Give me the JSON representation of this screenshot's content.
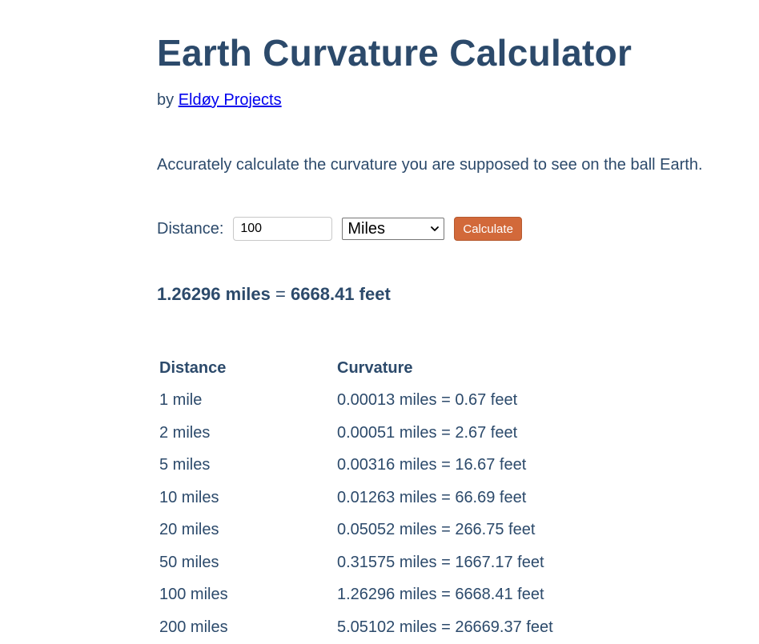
{
  "header": {
    "title": "Earth Curvature Calculator",
    "byline_prefix": "by",
    "author_link": "Eldøy Projects"
  },
  "intro": "Accurately calculate the curvature you are supposed to see on the ball Earth.",
  "form": {
    "distance_label": "Distance:",
    "distance_value": "100",
    "unit_selected": "Miles",
    "calculate_label": "Calculate"
  },
  "result": {
    "miles": "1.26296 miles",
    "equals": "=",
    "feet": "6668.41 feet"
  },
  "table": {
    "headers": [
      "Distance",
      "Curvature"
    ],
    "rows": [
      [
        "1 mile",
        "0.00013 miles = 0.67 feet"
      ],
      [
        "2 miles",
        "0.00051 miles = 2.67 feet"
      ],
      [
        "5 miles",
        "0.00316 miles = 16.67 feet"
      ],
      [
        "10 miles",
        "0.01263 miles = 66.69 feet"
      ],
      [
        "20 miles",
        "0.05052 miles = 266.75 feet"
      ],
      [
        "50 miles",
        "0.31575 miles = 1667.17 feet"
      ],
      [
        "100 miles",
        "1.26296 miles = 6668.41 feet"
      ],
      [
        "200 miles",
        "5.05102 miles = 26669.37 feet"
      ]
    ]
  },
  "colors": {
    "text": "#2c4a6b",
    "link": "#0000ee",
    "button": "#d2693a"
  }
}
